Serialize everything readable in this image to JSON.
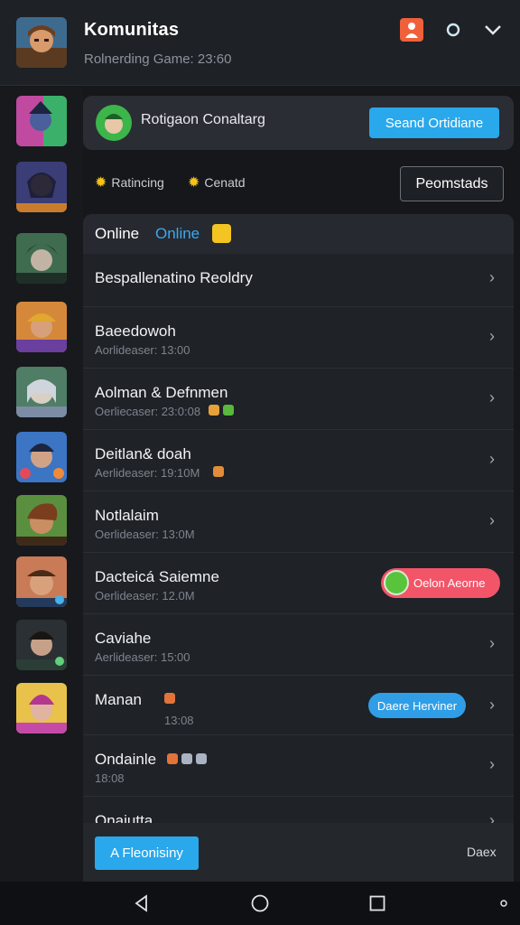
{
  "header": {
    "title": "Komunitas",
    "subtitle": "Rolnerding Game: 23:60",
    "icons": [
      "profile-icon",
      "search-icon",
      "chevron-down-icon"
    ]
  },
  "sidebar": {
    "avatars": [
      "avatar-1",
      "avatar-2",
      "avatar-3",
      "avatar-4",
      "avatar-5",
      "avatar-6",
      "avatar-7",
      "avatar-8",
      "avatar-9",
      "avatar-10"
    ]
  },
  "banner": {
    "text": "Rotigaon Conaltarg",
    "button": "Seand Ortidiane"
  },
  "filters": {
    "item1": "Ratincing",
    "item2": "Cenatd",
    "button": "Peomstads"
  },
  "list": {
    "header_label": "Online",
    "header_label_accent": "Online",
    "rows": [
      {
        "name": "Bespallenatino Reoldry",
        "meta": ""
      },
      {
        "name": "Baeedowoh",
        "meta": "Aorlideaser: 13:00"
      },
      {
        "name": "Aolman & Defnmen",
        "meta": "Oerliecaser: 23:0:08"
      },
      {
        "name": "Deitlan& doah",
        "meta": "Aerlideaser: 19:10M"
      },
      {
        "name": "Notlalaim",
        "meta": "Oerlideaser: 13:0M"
      },
      {
        "name": "Dacteicá Saiemne",
        "meta": "Oerlideaser: 12.0M",
        "pill": "Oelon Aeorne"
      },
      {
        "name": "Caviahe",
        "meta": "Aerlideaser: 15:00"
      },
      {
        "name": "Manan",
        "meta": "13:08",
        "pill": "Daere Herviner"
      },
      {
        "name": "Ondainle",
        "meta": "18:08"
      },
      {
        "name": "Onaiutta",
        "meta": ""
      }
    ]
  },
  "bottom": {
    "primary": "A Fleonisiny",
    "right": "Daex"
  },
  "navbar": {
    "icons": [
      "back-icon",
      "home-icon",
      "recents-icon"
    ]
  },
  "colors": {
    "accent": "#29a8ec",
    "background": "#15171b",
    "danger": "#f25468"
  }
}
